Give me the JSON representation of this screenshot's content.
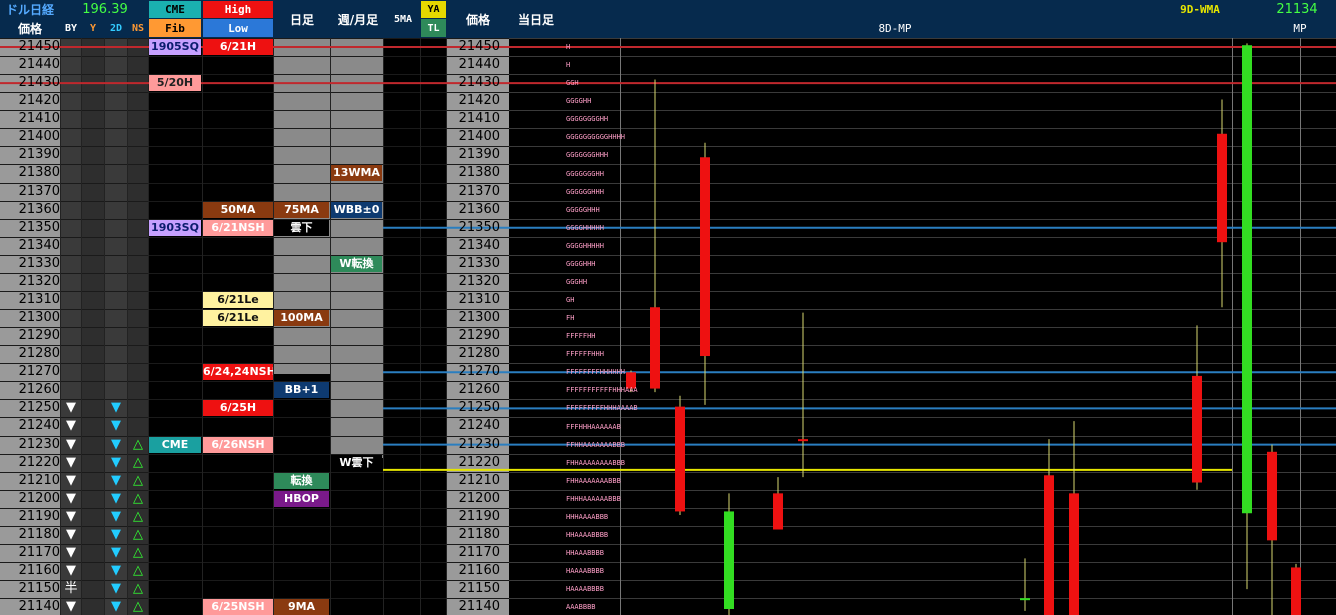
{
  "header": {
    "title_dollar_nikkei": "ドル日経",
    "value_dollar_nikkei": "196.39",
    "price_label": "価格",
    "by": "BY",
    "y": "Y",
    "twod": "2D",
    "ns": "NS",
    "cme": "CME",
    "fib": "Fib",
    "high": "High",
    "low": "Low",
    "daily": "日足",
    "weekly_monthly": "週/月足",
    "fivema": "5MA",
    "ya": "YA",
    "tl": "TL",
    "price_label2": "価格",
    "today_bar": "当日足",
    "mp8d": "8D-MP",
    "wma9d": "9D-WMA",
    "mp_value": "21134",
    "mp": "MP"
  },
  "prices": [
    "21450",
    "21440",
    "21430",
    "21420",
    "21410",
    "21400",
    "21390",
    "21380",
    "21370",
    "21360",
    "21350",
    "21340",
    "21330",
    "21320",
    "21310",
    "21300",
    "21290",
    "21280",
    "21270",
    "21260",
    "21250",
    "21240",
    "21230",
    "21220",
    "21210",
    "21200",
    "21190",
    "21180",
    "21170",
    "21160",
    "21150",
    "21140"
  ],
  "colors": {
    "header_bg": "#062a4d",
    "price_col_bg": "#9a9a9a",
    "grid_line": "#3a3a3a",
    "by_col_bg": "#3a3a3a",
    "y_col_bg": "#2e2e2e",
    "gray_col_bg": "#8a8a8a",
    "red_line": "#c0282d",
    "blue_line": "#2a7ec0",
    "yellow_line": "#e6e600",
    "bull": "#33dd22",
    "bear": "#ee1111",
    "wick": "#d8d870"
  },
  "markers": {
    "by_rows": [
      20,
      21,
      22,
      23,
      24,
      25,
      26,
      27,
      28,
      29,
      31
    ],
    "by_symbol": "▼",
    "by_special_row": 30,
    "by_special": "半",
    "twod_rows": [
      20,
      21,
      22,
      23,
      24,
      25,
      26,
      27,
      28,
      29,
      30,
      31
    ],
    "twod_symbol": "▼",
    "ns_rows": [
      22,
      23,
      24,
      25,
      26,
      27,
      28,
      29,
      30,
      31
    ],
    "ns_symbol": "△"
  },
  "labels": [
    {
      "col": "cme",
      "row": 0,
      "text": "1905SQ",
      "bg": "#c6a0ff",
      "fg": "#0b1d6e"
    },
    {
      "col": "hl",
      "row": 0,
      "text": "6/21H",
      "bg": "#ee1111",
      "fg": "#ffffff"
    },
    {
      "col": "cme",
      "row": 2,
      "text": "5/20H",
      "bg": "#ff9a9a",
      "fg": "#222222"
    },
    {
      "col": "wk",
      "row": 7,
      "text": "13WMA",
      "bg": "#8a3a10",
      "fg": "#ffffff"
    },
    {
      "col": "hl",
      "row": 9,
      "text": "50MA",
      "bg": "#8a3a10",
      "fg": "#ffffff"
    },
    {
      "col": "day",
      "row": 9,
      "text": "75MA",
      "bg": "#8a3a10",
      "fg": "#ffffff"
    },
    {
      "col": "wk",
      "row": 9,
      "text": "WBB±0",
      "bg": "#0e3a70",
      "fg": "#ffffff"
    },
    {
      "col": "cme",
      "row": 10,
      "text": "1903SQ",
      "bg": "#c6a0ff",
      "fg": "#0b1d6e"
    },
    {
      "col": "hl",
      "row": 10,
      "text": "6/21NSH",
      "bg": "#ff9a9a",
      "fg": "#ffffff"
    },
    {
      "col": "day",
      "row": 10,
      "text": "雲下",
      "bg": "#000000",
      "fg": "#ffffff"
    },
    {
      "col": "wk",
      "row": 12,
      "text": "W転換",
      "bg": "#2e8a5a",
      "fg": "#ffffff"
    },
    {
      "col": "hl",
      "row": 14,
      "text": "6/21Le",
      "bg": "#fff2a0",
      "fg": "#111111"
    },
    {
      "col": "hl",
      "row": 15,
      "text": "6/21Le",
      "bg": "#fff2a0",
      "fg": "#111111"
    },
    {
      "col": "day",
      "row": 15,
      "text": "100MA",
      "bg": "#8a3a10",
      "fg": "#ffffff"
    },
    {
      "col": "hl",
      "row": 18,
      "text": "6/24,24NSH",
      "bg": "#ee1111",
      "fg": "#ffffff"
    },
    {
      "col": "day",
      "row": 19,
      "text": "BB+1",
      "bg": "#0e3a70",
      "fg": "#ffffff"
    },
    {
      "col": "hl",
      "row": 20,
      "text": "6/25H",
      "bg": "#ee1111",
      "fg": "#ffffff"
    },
    {
      "col": "cme",
      "row": 22,
      "text": "CME",
      "bg": "#1aa0a0",
      "fg": "#ffffff"
    },
    {
      "col": "hl",
      "row": 22,
      "text": "6/26NSH",
      "bg": "#ff9a9a",
      "fg": "#ffffff"
    },
    {
      "col": "wk",
      "row": 23,
      "text": "W雲下",
      "bg": "#000000",
      "fg": "#ffffff"
    },
    {
      "col": "day",
      "row": 24,
      "text": "転換",
      "bg": "#2e8a5a",
      "fg": "#ffffff"
    },
    {
      "col": "day",
      "row": 25,
      "text": "HBOP",
      "bg": "#7a1a8a",
      "fg": "#ffffff"
    },
    {
      "col": "hl",
      "row": 31,
      "text": "6/25NSH",
      "bg": "#ff9a9a",
      "fg": "#ffffff"
    },
    {
      "col": "day",
      "row": 31,
      "text": "9MA",
      "bg": "#8a3a10",
      "fg": "#ffffff"
    }
  ],
  "tpo_profile": [
    "H",
    "H",
    "GGH",
    "GGGGHH",
    "GGGGGGGGHH",
    "GGGGGGGGGGHHHH",
    "GGGGGGGHHH",
    "GGGGGGGHH",
    "GGGGGGHHH",
    "GGGGGHHH",
    "GGGGHHHHH",
    "GGGGHHHHH",
    "GGGGHHH",
    "GGGHH",
    "GH",
    "FH",
    "FFFFFHH",
    "FFFFFFHHH",
    "FFFFFFFFHHHHHH",
    "FFFFFFFFFFFHHHAAA",
    "FFFFFFFFFHHHAAAAB",
    "FFFHHHAAAAAAB",
    "FFHHAAAAAAABBB",
    "FHHAAAAAAAABBB",
    "FHHAAAAAAABBB",
    "FHHHAAAAAABBB",
    "HHHAAAABBB",
    "HHAAAABBBB",
    "HHAAABBBB",
    "HAAAABBBB",
    "HAAAABBBB",
    "AAABBBB"
  ],
  "chart_data": {
    "type": "candlestick",
    "title": "",
    "ylabel": "価格",
    "ylim": [
      21135,
      21455
    ],
    "levels": [
      {
        "price": 21450,
        "color": "red"
      },
      {
        "price": 21430,
        "color": "red"
      },
      {
        "price": 21350,
        "color": "blue"
      },
      {
        "price": 21270,
        "color": "blue"
      },
      {
        "price": 21250,
        "color": "blue"
      },
      {
        "price": 21230,
        "color": "blue"
      },
      {
        "price": 21216,
        "color": "yellow"
      }
    ],
    "candles": [
      {
        "open": 21270,
        "close": 21261,
        "high": 21271,
        "low": 21259
      },
      {
        "open": 21306,
        "close": 21261,
        "high": 21432,
        "low": 21259
      },
      {
        "open": 21389,
        "close": 21279,
        "high": 21397,
        "low": 21252
      },
      {
        "open": 21251,
        "close": 21193,
        "high": 21257,
        "low": 21191
      },
      {
        "open": 21139,
        "close": 21193,
        "high": 21203,
        "low": 21135
      },
      {
        "open": 21203,
        "close": 21183,
        "high": 21212,
        "low": 21183
      },
      {
        "open": 21233,
        "close": 21232,
        "high": 21303,
        "low": 21212
      },
      {
        "open": 21145,
        "close": 21145,
        "high": 21167,
        "low": 21138
      },
      {
        "open": 21213,
        "close": 21135,
        "high": 21233,
        "low": 21135
      },
      {
        "open": 21203,
        "close": 21135,
        "high": 21243,
        "low": 21135
      },
      {
        "open": 21268,
        "close": 21209,
        "high": 21296,
        "low": 21205
      },
      {
        "open": 21402,
        "close": 21342,
        "high": 21421,
        "low": 21306
      },
      {
        "open": 21192,
        "close": 21451,
        "high": 21452,
        "low": 21150
      },
      {
        "open": 21226,
        "close": 21177,
        "high": 21230,
        "low": 21135
      },
      {
        "open": 21162,
        "close": 21135,
        "high": 21164,
        "low": 21135
      }
    ]
  }
}
